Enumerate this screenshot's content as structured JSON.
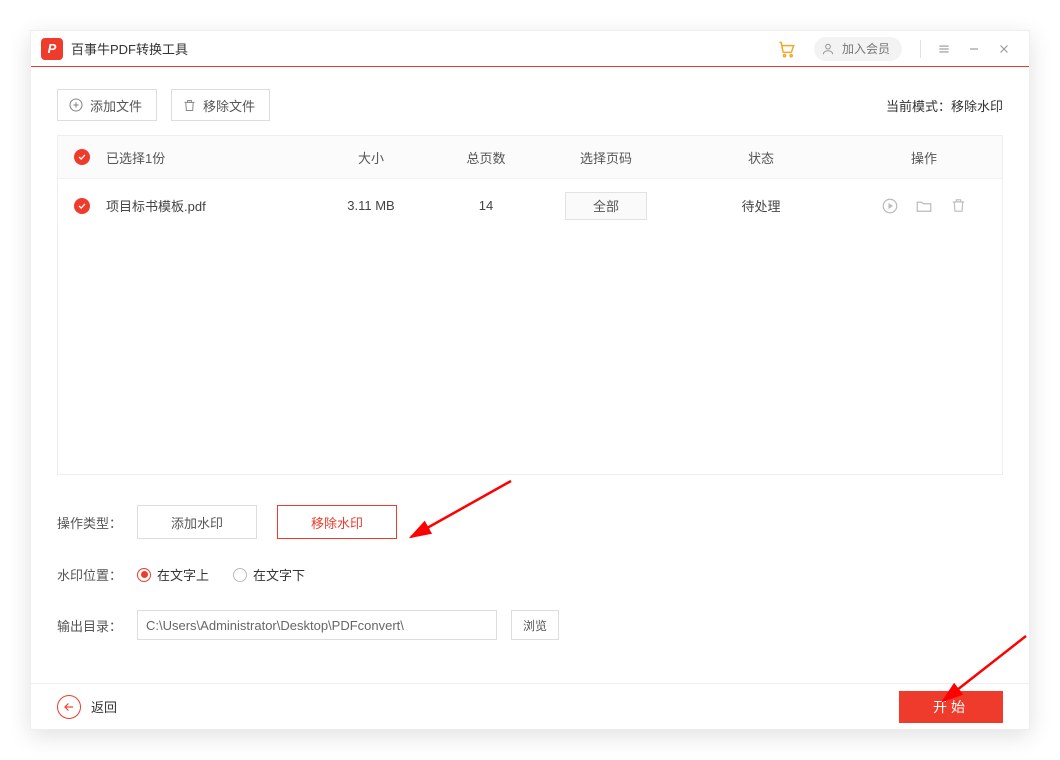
{
  "app": {
    "title": "百事牛PDF转换工具",
    "logo_letter": "P"
  },
  "header": {
    "join_label": "加入会员"
  },
  "toolbar": {
    "add_file": "添加文件",
    "remove_file": "移除文件",
    "mode_prefix": "当前模式：",
    "mode_value": "移除水印"
  },
  "table": {
    "headers": {
      "selected": "已选择1份",
      "size": "大小",
      "pages": "总页数",
      "page_select": "选择页码",
      "status": "状态",
      "ops": "操作"
    },
    "rows": [
      {
        "filename": "项目标书模板.pdf",
        "size": "3.11 MB",
        "pages": "14",
        "page_select": "全部",
        "status": "待处理"
      }
    ]
  },
  "options": {
    "type_label": "操作类型：",
    "type_add": "添加水印",
    "type_remove": "移除水印",
    "pos_label": "水印位置：",
    "pos_over": "在文字上",
    "pos_under": "在文字下",
    "out_label": "输出目录：",
    "out_path": "C:\\Users\\Administrator\\Desktop\\PDFconvert\\",
    "browse": "浏览"
  },
  "footer": {
    "back": "返回",
    "start": "开始"
  }
}
